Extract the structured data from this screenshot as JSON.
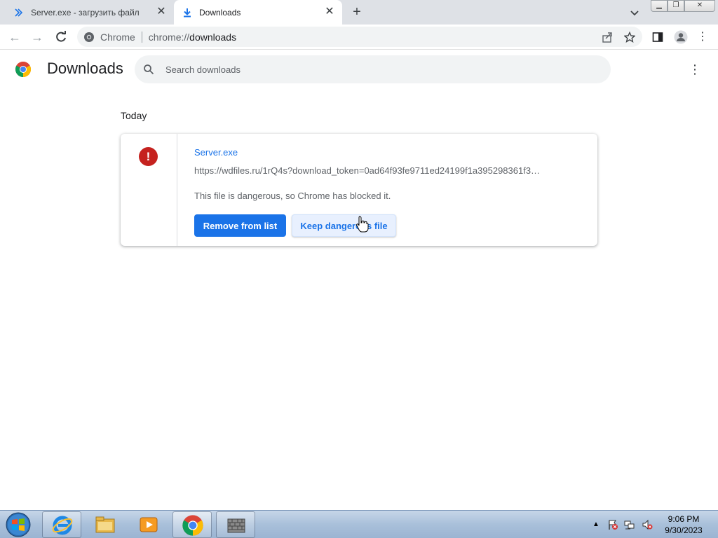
{
  "tabs": [
    {
      "title": "Server.exe - загрузить файл",
      "icon": "chevrons-icon"
    },
    {
      "title": "Downloads",
      "icon": "download-icon"
    }
  ],
  "toolbar": {
    "site_chip": "Chrome",
    "url_prefix": "chrome://",
    "url_host": "downloads"
  },
  "page": {
    "title": "Downloads",
    "search_placeholder": "Search downloads"
  },
  "downloads": {
    "date_group": "Today",
    "item": {
      "file_name": "Server.exe",
      "url": "https://wdfiles.ru/1rQ4s?download_token=0ad64f93fe9711ed24199f1a395298361f3…",
      "status": "This file is dangerous, so Chrome has blocked it.",
      "primary_action": "Remove from list",
      "secondary_action": "Keep dangerous file"
    }
  },
  "taskbar": {
    "time": "9:06 PM",
    "date": "9/30/2023"
  },
  "colors": {
    "accent": "#1a73e8",
    "danger": "#c5221f"
  }
}
